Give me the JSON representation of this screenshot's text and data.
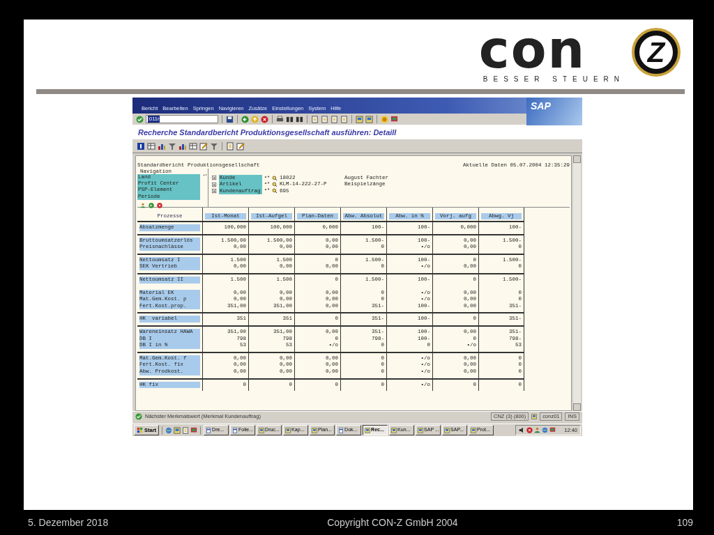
{
  "slide": {
    "logo": {
      "wordmark": "con",
      "emblem": "Z",
      "tagline": "BESSER STEUERN"
    },
    "footer": {
      "date": "5. Dezember 2018",
      "copyright": "Copyright CON-Z GmbH 2004",
      "page": "109"
    }
  },
  "sap": {
    "brand": "SAP",
    "menu": [
      "Bericht",
      "Bearbeiten",
      "Springen",
      "Navigieren",
      "Zusätze",
      "Einstellungen",
      "System",
      "Hilfe"
    ],
    "command": ":011r",
    "title": "Recherche Standardbericht Produktionsgesellschaft ausführen: Detaill",
    "report": {
      "name": "Standardbericht Produktionsgesellschaft",
      "timestamp": "Aktuelle Daten 05.07.2004 12:35:29",
      "navigation": {
        "title": "Navigation",
        "characteristics": [
          "Land",
          "Profit Center",
          "PSP-Element",
          "Periode"
        ],
        "filters": [
          {
            "label": "Kunde",
            "value": "18022",
            "text": "August Fachter"
          },
          {
            "label": "Artikel",
            "value": "KLM-14-222-27-P",
            "text": "Beispielzänge"
          },
          {
            "label": "Kundenauftrag",
            "value": "695"
          }
        ]
      },
      "table": {
        "columns": [
          "Prozesse",
          "Ist-Monat",
          "Ist-Aufgel",
          "Plan-Daten",
          "Abw. Absolut",
          "Abw. in %",
          "Vorj. aufg",
          "Abwg. Vj"
        ],
        "groups": [
          {
            "ruled": true,
            "rows": [
              {
                "label": "Absatzmenge",
                "values": [
                  "100,000",
                  "100,000",
                  "0,000",
                  "100-",
                  "100-",
                  "0,000",
                  "100-"
                ]
              }
            ]
          },
          {
            "ruled": true,
            "rows": [
              {
                "label": "Bruttoumsatzerlös",
                "values": [
                  "1.500,00",
                  "1.500,00",
                  "0,00",
                  "1.500-",
                  "100-",
                  "0,00",
                  "1.500-"
                ]
              },
              {
                "label": "Preisnachlässe",
                "values": [
                  "0,00",
                  "0,00",
                  "0,00",
                  "0",
                  "•/o",
                  "0,00",
                  "0"
                ]
              }
            ]
          },
          {
            "ruled": true,
            "rows": [
              {
                "label": "Nettoumsatz I",
                "values": [
                  "1.500",
                  "1.500",
                  "0",
                  "1.500-",
                  "100-",
                  "0",
                  "1.500-"
                ]
              },
              {
                "label": "SEK Vertrieb",
                "values": [
                  "0,00",
                  "0,00",
                  "0,00",
                  "0",
                  "•/o",
                  "0,00",
                  "0"
                ]
              }
            ]
          },
          {
            "ruled": true,
            "rows": [
              {
                "label": "Nettoumsatz II",
                "values": [
                  "1.500",
                  "1.500",
                  "0",
                  "1.500-",
                  "100-",
                  "0",
                  "1.500-"
                ]
              }
            ]
          },
          {
            "ruled": false,
            "rows": [
              {
                "label": "Material EK",
                "values": [
                  "0,00",
                  "0,00",
                  "0,00",
                  "0",
                  "•/o",
                  "0,00",
                  "0"
                ]
              },
              {
                "label": "Mat.Gem.Kost. p",
                "values": [
                  "0,00",
                  "0,00",
                  "0,00",
                  "0",
                  "•/o",
                  "0,00",
                  "0"
                ]
              },
              {
                "label": "Fert.Kost.prop.",
                "values": [
                  "351,00",
                  "351,00",
                  "0,00",
                  "351-",
                  "100-",
                  "0,00",
                  "351-"
                ]
              }
            ]
          },
          {
            "ruled": true,
            "rows": [
              {
                "label": "HK  variabel",
                "values": [
                  "351",
                  "351",
                  "0",
                  "351-",
                  "100-",
                  "0",
                  "351-"
                ]
              }
            ]
          },
          {
            "ruled": true,
            "rows": [
              {
                "label": "Wareneinsatz HAWA",
                "values": [
                  "351,00",
                  "351,00",
                  "0,00",
                  "351-",
                  "100-",
                  "0,00",
                  "351-"
                ]
              },
              {
                "label": "DB I",
                "values": [
                  "798",
                  "798",
                  "0",
                  "798-",
                  "100-",
                  "0",
                  "798-"
                ]
              },
              {
                "label": "DB I in %",
                "values": [
                  "53",
                  "53",
                  "•/o",
                  "0",
                  "0",
                  "•/o",
                  "53"
                ]
              }
            ]
          },
          {
            "ruled": true,
            "rows": [
              {
                "label": "Mat.Gem.Kost. f",
                "values": [
                  "0,00",
                  "0,00",
                  "0,00",
                  "0",
                  "•/o",
                  "0,00",
                  "0"
                ]
              },
              {
                "label": "Fert.Kost. fix",
                "values": [
                  "0,00",
                  "0,00",
                  "0,00",
                  "0",
                  "•/o",
                  "0,00",
                  "0"
                ]
              },
              {
                "label": "Abw. Prodkost.",
                "values": [
                  "0,00",
                  "0,00",
                  "0,00",
                  "0",
                  "•/o",
                  "0,00",
                  "0"
                ]
              }
            ]
          },
          {
            "ruled": true,
            "rows": [
              {
                "label": "HK fix",
                "values": [
                  "0",
                  "0",
                  "0",
                  "0",
                  "•/o",
                  "0",
                  "0"
                ]
              }
            ]
          }
        ]
      }
    },
    "status_bar": {
      "message": "Nächster Merkmalswert (Merkmal Kundenauftrag)",
      "system": "CNZ (3) (800)",
      "user": "conz01",
      "mode": "INS"
    },
    "taskbar": {
      "start": "Start",
      "tasks": [
        {
          "label": "Dre...",
          "selected": false
        },
        {
          "label": "Folie...",
          "selected": false
        },
        {
          "label": "Druc...",
          "selected": false
        },
        {
          "label": "Kap...",
          "selected": false
        },
        {
          "label": "Plan...",
          "selected": false
        },
        {
          "label": "Dok...",
          "selected": false
        },
        {
          "label": "Rec...",
          "selected": true
        },
        {
          "label": "Kun...",
          "selected": false
        },
        {
          "label": "SAP ...",
          "selected": false
        },
        {
          "label": "SAP...",
          "selected": false
        },
        {
          "label": "Prot...",
          "selected": false
        }
      ],
      "clock": "12:40"
    }
  }
}
